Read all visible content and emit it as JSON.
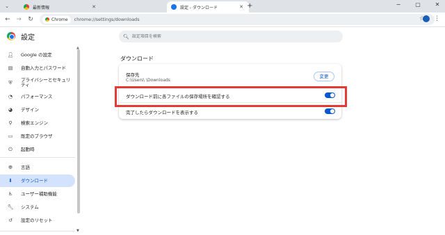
{
  "browser": {
    "tabs": [
      {
        "title": "最新情報",
        "active": false
      },
      {
        "title": "設定 - ダウンロード",
        "active": true
      }
    ],
    "new_tab_label": "+",
    "window_controls": {
      "minimize": "−",
      "maximize": "▢",
      "close": "✕"
    },
    "omnibox": {
      "chip_label": "Chrome",
      "url": "chrome://settings/downloads"
    }
  },
  "settings": {
    "title": "設定",
    "search_placeholder": "設定項目を検索"
  },
  "sidebar": {
    "items": [
      {
        "label": "Google の設定",
        "icon": "person-icon"
      },
      {
        "label": "自動入力とパスワード",
        "icon": "clipboard-icon"
      },
      {
        "label": "プライバシーとセキュリティ",
        "icon": "shield-icon"
      },
      {
        "label": "パフォーマンス",
        "icon": "speedometer-icon"
      },
      {
        "label": "デザイン",
        "icon": "palette-icon"
      },
      {
        "label": "検索エンジン",
        "icon": "search-icon"
      },
      {
        "label": "既定のブラウザ",
        "icon": "browser-icon"
      },
      {
        "label": "起動時",
        "icon": "power-icon"
      },
      {
        "label": "言語",
        "icon": "globe-icon"
      },
      {
        "label": "ダウンロード",
        "icon": "download-icon",
        "active": true
      },
      {
        "label": "ユーザー補助機能",
        "icon": "accessibility-icon"
      },
      {
        "label": "システム",
        "icon": "wrench-icon"
      },
      {
        "label": "設定のリセット",
        "icon": "reset-icon"
      }
    ]
  },
  "downloads": {
    "section_title": "ダウンロード",
    "location_label": "保存先",
    "location_path": "C:\\Users\\        \\Downloads",
    "change_button": "変更",
    "ask_label": "ダウンロード前に各ファイルの保存場所を確認する",
    "ask_enabled": true,
    "show_label": "完了したらダウンロードを表示する",
    "show_enabled": true
  },
  "colors": {
    "accent": "#0b57d0",
    "highlight": "#e53935",
    "active_nav_bg": "#d3e3fd"
  }
}
